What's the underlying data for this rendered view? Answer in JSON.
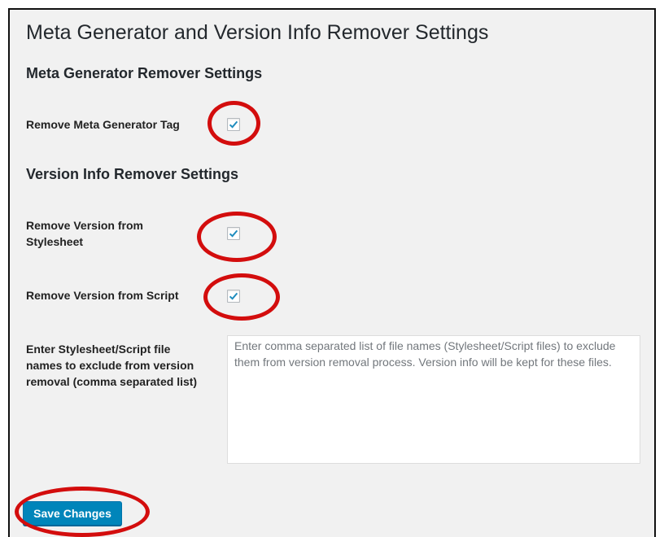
{
  "page": {
    "title": "Meta Generator and Version Info Remover Settings"
  },
  "meta_section": {
    "title": "Meta Generator Remover Settings",
    "fields": [
      {
        "label": "Remove Meta Generator Tag",
        "checked": true
      }
    ]
  },
  "version_section": {
    "title": "Version Info Remover Settings",
    "fields": [
      {
        "label": "Remove Version from Stylesheet",
        "checked": true
      },
      {
        "label": "Remove Version from Script",
        "checked": true
      }
    ],
    "exclude": {
      "label": "Enter Stylesheet/Script file names to exclude from version removal (comma separated list)",
      "placeholder": "Enter comma separated list of file names (Stylesheet/Script files) to exclude them from version removal process. Version info will be kept for these files.",
      "value": ""
    }
  },
  "actions": {
    "save_label": "Save Changes"
  },
  "colors": {
    "accent": "#0085ba",
    "highlight": "#d30d0d",
    "checkmark": "#1e8cbe"
  }
}
